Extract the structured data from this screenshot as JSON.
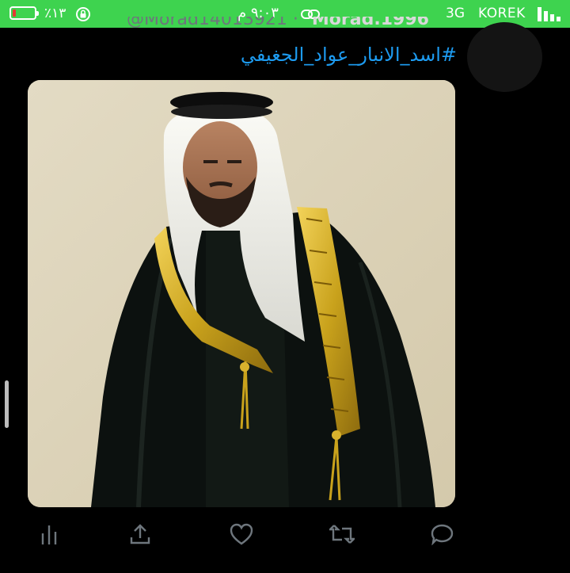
{
  "status_bar": {
    "battery_percent_label": "٪١٣",
    "battery_level": 0.13,
    "time": "٩:٠٣ م",
    "network": "3G",
    "carrier": "KOREK",
    "colors": {
      "bar": "#3ed34f",
      "battery_low": "#e53935"
    }
  },
  "tweet": {
    "display_name": "Morad.1996",
    "handle": "@Morad14013921 ·",
    "hashtag": "#اسد_الانبار_عواد_الجغيفي",
    "link_color": "#1d9bf0",
    "actions": [
      "analytics-icon",
      "share-icon",
      "like-icon",
      "retweet-icon",
      "reply-icon"
    ]
  }
}
